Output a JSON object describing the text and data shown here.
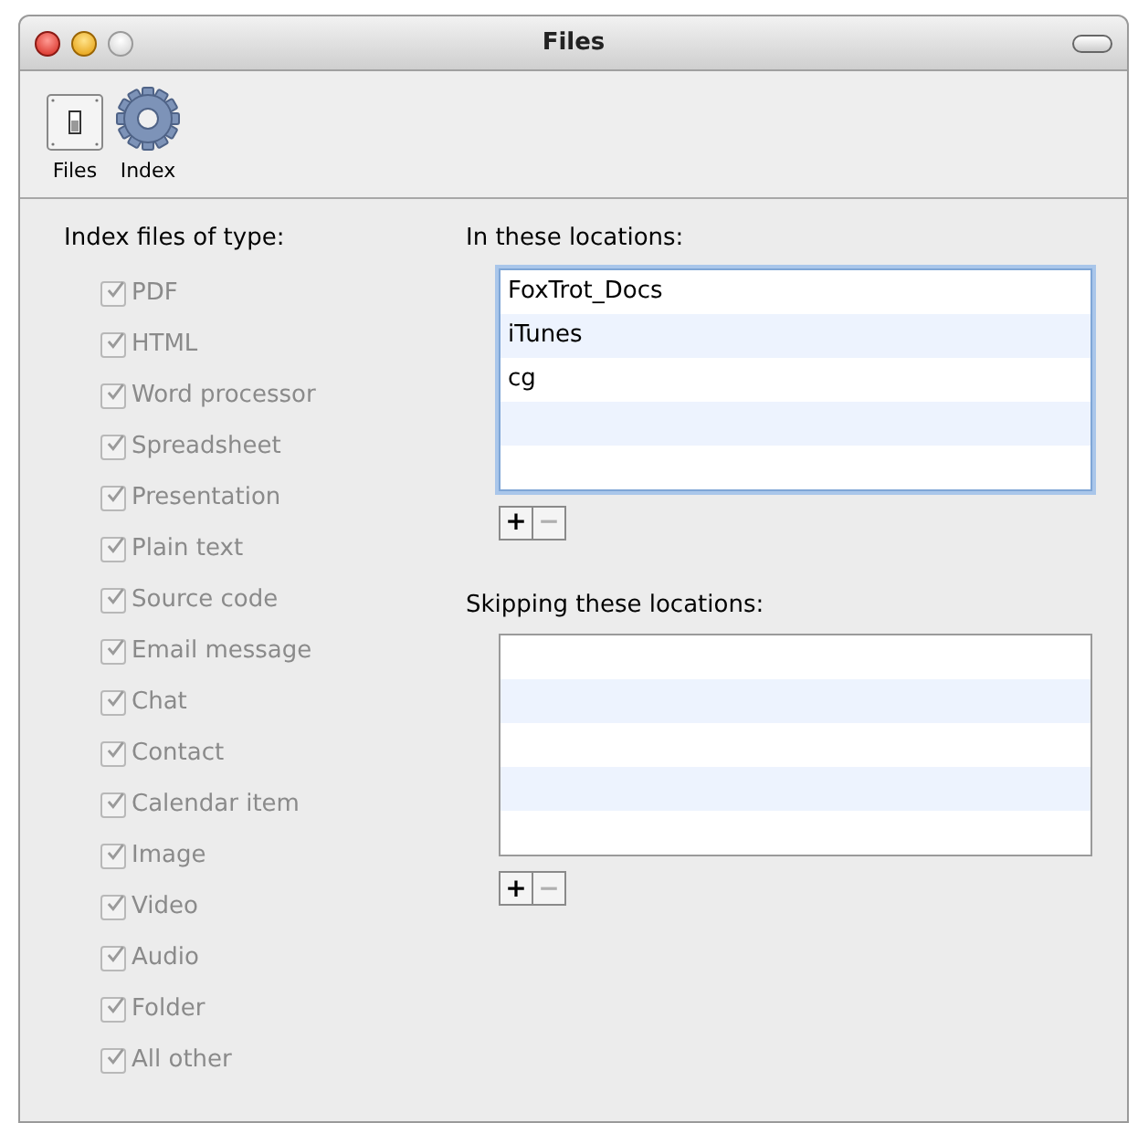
{
  "window": {
    "title": "Files"
  },
  "toolbar": [
    {
      "label": "Files",
      "kind": "switch"
    },
    {
      "label": "Index",
      "kind": "gear"
    }
  ],
  "file_types": {
    "heading": "Index files of type:",
    "items": [
      {
        "label": "PDF",
        "checked": true,
        "disabled": true
      },
      {
        "label": "HTML",
        "checked": true,
        "disabled": true
      },
      {
        "label": "Word processor",
        "checked": true,
        "disabled": true
      },
      {
        "label": "Spreadsheet",
        "checked": true,
        "disabled": true
      },
      {
        "label": "Presentation",
        "checked": true,
        "disabled": true
      },
      {
        "label": "Plain text",
        "checked": true,
        "disabled": true
      },
      {
        "label": "Source code",
        "checked": true,
        "disabled": true
      },
      {
        "label": "Email message",
        "checked": true,
        "disabled": true
      },
      {
        "label": "Chat",
        "checked": true,
        "disabled": true
      },
      {
        "label": "Contact",
        "checked": true,
        "disabled": true
      },
      {
        "label": "Calendar item",
        "checked": true,
        "disabled": true
      },
      {
        "label": "Image",
        "checked": true,
        "disabled": true
      },
      {
        "label": "Video",
        "checked": true,
        "disabled": true
      },
      {
        "label": "Audio",
        "checked": true,
        "disabled": true
      },
      {
        "label": "Folder",
        "checked": true,
        "disabled": true
      },
      {
        "label": "All other",
        "checked": true,
        "disabled": true
      }
    ]
  },
  "include": {
    "heading": "In these locations:",
    "focused": true,
    "rows": [
      "FoxTrot_Docs",
      "iTunes",
      "cg"
    ],
    "buttons": [
      {
        "label": "+",
        "disabled": false
      },
      {
        "label": "−",
        "disabled": true
      }
    ]
  },
  "exclude": {
    "heading": "Skipping these locations:",
    "focused": false,
    "buttons": [
      {
        "label": "+",
        "disabled": false
      },
      {
        "label": "−",
        "disabled": true
      }
    ]
  }
}
